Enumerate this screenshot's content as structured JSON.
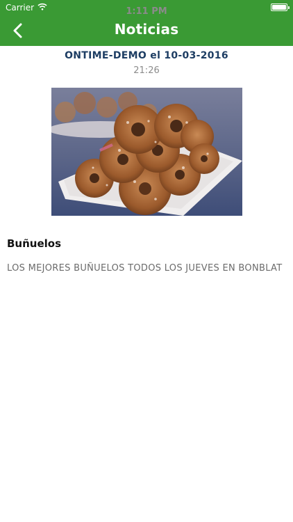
{
  "status_bar": {
    "carrier": "Carrier",
    "time": "1:11 PM"
  },
  "nav": {
    "title": "Noticias",
    "back_icon": "chevron-left-icon"
  },
  "news": {
    "author_date": "ONTIME-DEMO el 10-03-2016",
    "time": "21:26",
    "title": "Buñuelos",
    "description": "LOS MEJORES BUÑUELOS TODOS LOS JUEVES EN BONBLAT"
  },
  "colors": {
    "header": "#3a9a34",
    "author": "#1d3d63"
  }
}
